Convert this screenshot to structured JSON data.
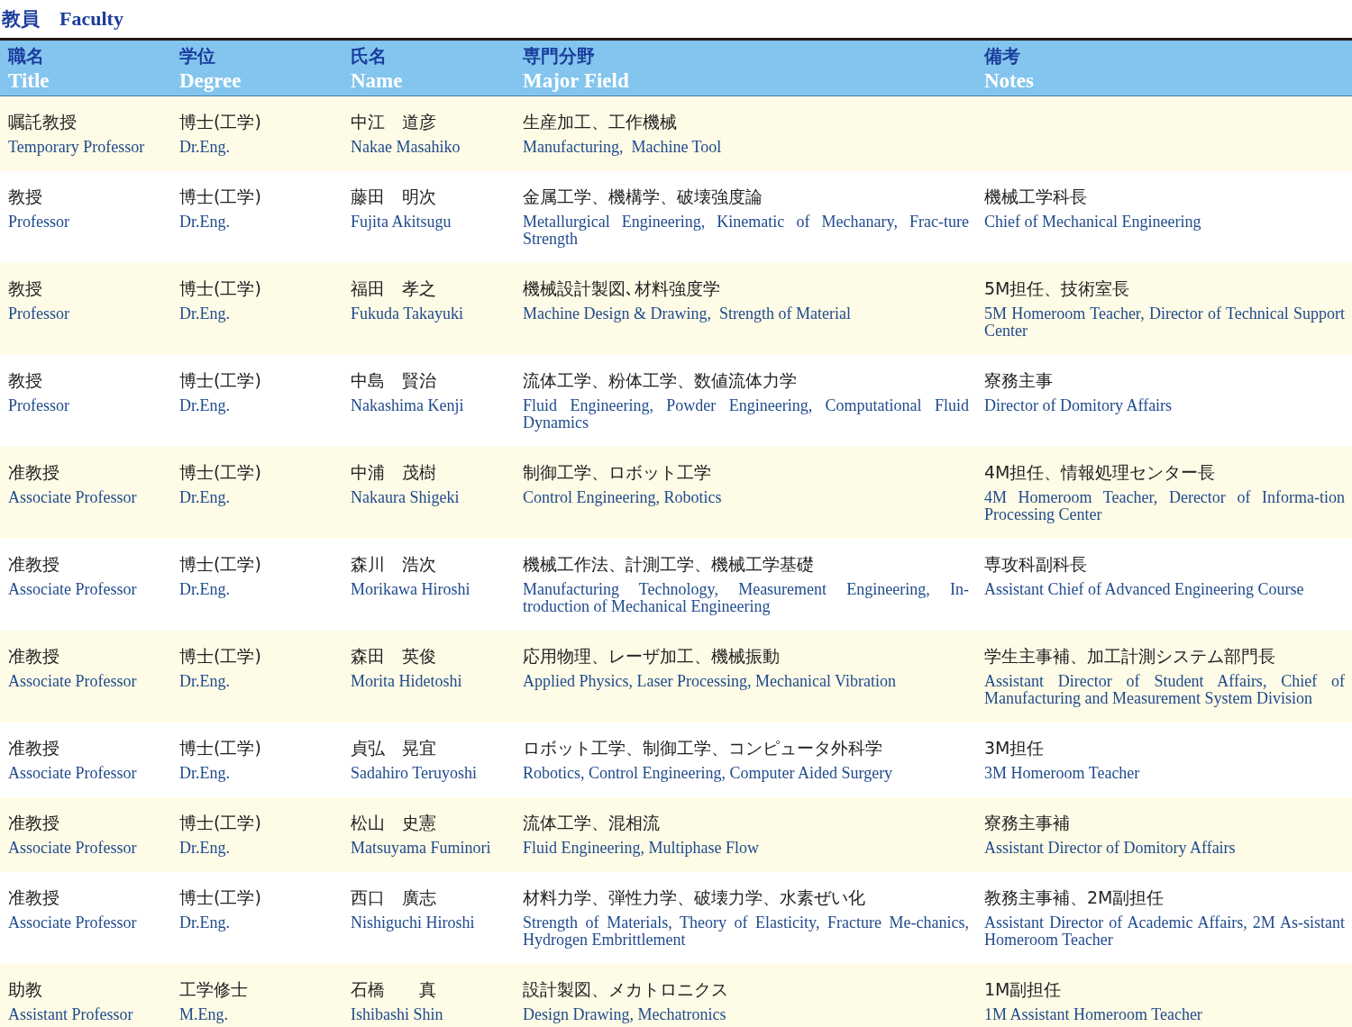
{
  "heading": {
    "ja": "教員",
    "en": "Faculty"
  },
  "columns": [
    {
      "ja": "職名",
      "en": "Title"
    },
    {
      "ja": "学位",
      "en": "Degree"
    },
    {
      "ja": "氏名",
      "en": "Name"
    },
    {
      "ja": "専門分野",
      "en": "Major Field"
    },
    {
      "ja": "備考",
      "en": "Notes"
    }
  ],
  "rows": [
    {
      "cells": [
        {
          "ja": "嘱託教授",
          "en": "Temporary Professor"
        },
        {
          "ja": "博士(工学)",
          "en": "Dr.Eng."
        },
        {
          "ja": "中江　道彦",
          "en": "Nakae Masahiko"
        },
        {
          "ja": "生産加工、工作機械",
          "en": "Manufacturing,  Machine Tool"
        }
      ]
    },
    {
      "cells": [
        {
          "ja": "教授",
          "en": "Professor"
        },
        {
          "ja": "博士(工学)",
          "en": "Dr.Eng."
        },
        {
          "ja": "藤田　明次",
          "en": "Fujita Akitsugu"
        },
        {
          "ja": "金属工学、機構学、破壊強度論",
          "en": "Metallurgical Engineering, Kinematic of Mechanary, Frac-ture Strength"
        },
        {
          "ja": "機械工学科長",
          "en": "Chief of Mechanical Engineering"
        }
      ]
    },
    {
      "cells": [
        {
          "ja": "教授",
          "en": "Professor"
        },
        {
          "ja": "博士(工学)",
          "en": "Dr.Eng."
        },
        {
          "ja": "福田　孝之",
          "en": "Fukuda Takayuki"
        },
        {
          "ja": "機械設計製図､材料強度学",
          "en": "Machine Design & Drawing,  Strength of Material"
        },
        {
          "ja": "5M担任、技術室長",
          "en": "5M Homeroom Teacher, Director of Technical Support Center"
        }
      ]
    },
    {
      "cells": [
        {
          "ja": "教授",
          "en": "Professor"
        },
        {
          "ja": "博士(工学)",
          "en": "Dr.Eng."
        },
        {
          "ja": "中島　賢治",
          "en": "Nakashima Kenji"
        },
        {
          "ja": "流体工学、粉体工学、数値流体力学",
          "en": "Fluid Engineering, Powder Engineering, Computational Fluid Dynamics"
        },
        {
          "ja": "寮務主事",
          "en": "Director of Domitory Affairs"
        }
      ]
    },
    {
      "cells": [
        {
          "ja": "准教授",
          "en": "Associate Professor"
        },
        {
          "ja": "博士(工学)",
          "en": "Dr.Eng."
        },
        {
          "ja": "中浦　茂樹",
          "en": "Nakaura Shigeki"
        },
        {
          "ja": "制御工学、ロボット工学",
          "en": "Control Engineering, Robotics"
        },
        {
          "ja": "4M担任、情報処理センター長",
          "en": "4M Homeroom Teacher, Derector of Informa-tion Processing Center"
        }
      ]
    },
    {
      "cells": [
        {
          "ja": "准教授",
          "en": "Associate Professor"
        },
        {
          "ja": "博士(工学)",
          "en": "Dr.Eng."
        },
        {
          "ja": "森川　浩次",
          "en": "Morikawa Hiroshi"
        },
        {
          "ja": "機械工作法、計測工学、機械工学基礎",
          "en": "Manufacturing Technology, Measurement Engineering, In-troduction of Mechanical Engineering"
        },
        {
          "ja": "専攻科副科長",
          "en": "Assistant Chief of Advanced Engineering Course"
        }
      ]
    },
    {
      "cells": [
        {
          "ja": "准教授",
          "en": "Associate Professor"
        },
        {
          "ja": "博士(工学)",
          "en": "Dr.Eng."
        },
        {
          "ja": "森田　英俊",
          "en": "Morita Hidetoshi"
        },
        {
          "ja": "応用物理、レーザ加工、機械振動",
          "en": "Applied Physics, Laser Processing, Mechanical Vibration"
        },
        {
          "ja": "学生主事補、加工計測システム部門長",
          "en": "Assistant Director of Student Affairs, Chief of Manufacturing and Measurement System Division"
        }
      ]
    },
    {
      "cells": [
        {
          "ja": "准教授",
          "en": "Associate Professor"
        },
        {
          "ja": "博士(工学)",
          "en": "Dr.Eng."
        },
        {
          "ja": "貞弘　晃宜",
          "en": "Sadahiro Teruyoshi"
        },
        {
          "ja": "ロボット工学、制御工学、コンピュータ外科学",
          "en": "Robotics, Control Engineering, Computer Aided Surgery"
        },
        {
          "ja": "3M担任",
          "en": "3M Homeroom Teacher"
        }
      ]
    },
    {
      "cells": [
        {
          "ja": "准教授",
          "en": "Associate Professor"
        },
        {
          "ja": "博士(工学)",
          "en": "Dr.Eng."
        },
        {
          "ja": "松山　史憲",
          "en": "Matsuyama Fuminori"
        },
        {
          "ja": "流体工学、混相流",
          "en": "Fluid Engineering, Multiphase Flow"
        },
        {
          "ja": "寮務主事補",
          "en": "Assistant Director of Domitory Affairs"
        }
      ]
    },
    {
      "cells": [
        {
          "ja": "准教授",
          "en": "Associate Professor"
        },
        {
          "ja": "博士(工学)",
          "en": "Dr.Eng."
        },
        {
          "ja": "西口　廣志",
          "en": "Nishiguchi Hiroshi"
        },
        {
          "ja": "材料力学、弾性力学、破壊力学、水素ぜい化",
          "en": "Strength of Materials, Theory of Elasticity, Fracture Me-chanics, Hydrogen Embrittlement"
        },
        {
          "ja": "教務主事補、2M副担任",
          "en": "Assistant Director of Academic Affairs, 2M As-sistant Homeroom Teacher"
        }
      ]
    },
    {
      "cells": [
        {
          "ja": "助教",
          "en": "Assistant Professor"
        },
        {
          "ja": "工学修士",
          "en": "M.Eng."
        },
        {
          "ja": "石橋　　真",
          "en": "Ishibashi Shin"
        },
        {
          "ja": "設計製図、メカトロニクス",
          "en": "Design Drawing, Mechatronics"
        },
        {
          "ja": "1M副担任",
          "en": "1M Assistant Homeroom Teacher"
        }
      ]
    }
  ]
}
